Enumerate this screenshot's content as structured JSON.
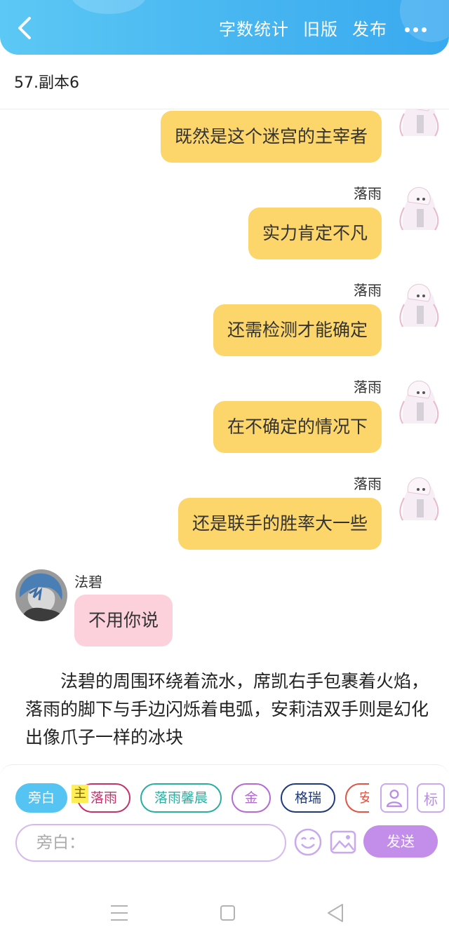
{
  "header": {
    "actions": [
      "字数统计",
      "旧版",
      "发布"
    ],
    "gradient": [
      "#5cc8f5",
      "#3aaaf0"
    ]
  },
  "chapter": {
    "title": "57.副本6"
  },
  "messages": [
    {
      "side": "right",
      "speaker": "",
      "text": "既然是这个迷宫的主宰者"
    },
    {
      "side": "right",
      "speaker": "落雨",
      "text": "实力肯定不凡"
    },
    {
      "side": "right",
      "speaker": "落雨",
      "text": "还需检测才能确定"
    },
    {
      "side": "right",
      "speaker": "落雨",
      "text": "在不确定的情况下"
    },
    {
      "side": "right",
      "speaker": "落雨",
      "text": "还是联手的胜率大一些"
    },
    {
      "side": "left",
      "speaker": "法碧",
      "text": "不用你说"
    }
  ],
  "narration": "法碧的周围环绕着流水，席凯右手包裹着火焰，落雨的脚下与手边闪烁着电弧，安莉洁双手则是幻化出像爪子一样的冰块",
  "composer": {
    "tag": "主",
    "roles": [
      {
        "label": "旁白",
        "color": "#55c4f2",
        "selected": true
      },
      {
        "label": "落雨",
        "color": "#c2336a"
      },
      {
        "label": "落雨馨晨",
        "color": "#2aaea0"
      },
      {
        "label": "金",
        "color": "#b46ad2"
      },
      {
        "label": "格瑞",
        "color": "#1e3a7a"
      },
      {
        "label": "安",
        "color": "#e05545"
      }
    ],
    "side_icons": [
      "person-card-icon",
      "标"
    ],
    "input_placeholder": "旁白：",
    "send_label": "发送",
    "accent": "#c28ee9"
  },
  "sysnav": [
    "menu-icon",
    "home-icon",
    "back-triangle-icon"
  ]
}
